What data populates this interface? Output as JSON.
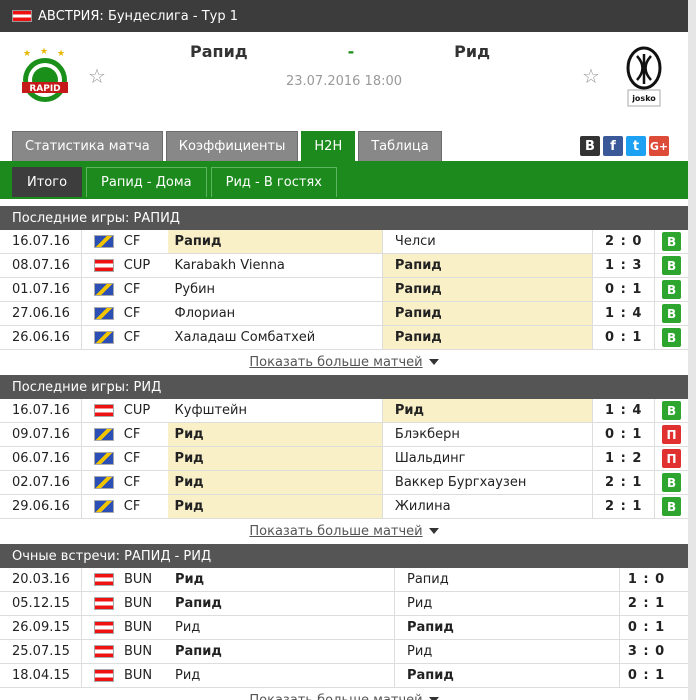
{
  "topbar": {
    "title": "АВСТРИЯ: Бундеслига - Тур 1"
  },
  "match": {
    "home": "Рапид",
    "separator": "-",
    "away": "Рид",
    "datetime": "23.07.2016 18:00",
    "home_logo_text": "RAPID",
    "away_logo_text": "josko"
  },
  "tabs": [
    "Статистика матча",
    "Коэффициенты",
    "H2H",
    "Таблица"
  ],
  "active_tab": "H2H",
  "social": [
    {
      "label": "В",
      "color": "#333333"
    },
    {
      "label": "f",
      "color": "#3b5998"
    },
    {
      "label": "t",
      "color": "#1da1f2"
    },
    {
      "label": "G+",
      "color": "#dd4b39"
    }
  ],
  "subtabs": [
    "Итого",
    "Рапид - Дома",
    "Рид - В гостях"
  ],
  "more_label": "Показать больше матчей",
  "sections": [
    {
      "title": "Последние игры: РАПИД",
      "rows": [
        {
          "date": "16.07.16",
          "league": "CF",
          "flag": "cf",
          "home": "Рапид",
          "away": "Челси",
          "score": "2 : 0",
          "result": "В",
          "hl": "home"
        },
        {
          "date": "08.07.16",
          "league": "CUP",
          "flag": "at",
          "home": "Karabakh Vienna",
          "away": "Рапид",
          "score": "1 : 3",
          "result": "В",
          "hl": "away"
        },
        {
          "date": "01.07.16",
          "league": "CF",
          "flag": "cf",
          "home": "Рубин",
          "away": "Рапид",
          "score": "0 : 1",
          "result": "В",
          "hl": "away"
        },
        {
          "date": "27.06.16",
          "league": "CF",
          "flag": "cf",
          "home": "Флориан",
          "away": "Рапид",
          "score": "1 : 4",
          "result": "В",
          "hl": "away"
        },
        {
          "date": "26.06.16",
          "league": "CF",
          "flag": "cf",
          "home": "Халадаш Сомбатхей",
          "away": "Рапид",
          "score": "0 : 1",
          "result": "В",
          "hl": "away"
        }
      ]
    },
    {
      "title": "Последние игры: РИД",
      "rows": [
        {
          "date": "16.07.16",
          "league": "CUP",
          "flag": "at",
          "home": "Куфштейн",
          "away": "Рид",
          "score": "1 : 4",
          "result": "В",
          "hl": "away"
        },
        {
          "date": "09.07.16",
          "league": "CF",
          "flag": "cf",
          "home": "Рид",
          "away": "Блэкберн",
          "score": "0 : 1",
          "result": "П",
          "hl": "home"
        },
        {
          "date": "06.07.16",
          "league": "CF",
          "flag": "cf",
          "home": "Рид",
          "away": "Шальдинг",
          "score": "1 : 2",
          "result": "П",
          "hl": "home"
        },
        {
          "date": "02.07.16",
          "league": "CF",
          "flag": "cf",
          "home": "Рид",
          "away": "Ваккер Бургхаузен",
          "score": "2 : 1",
          "result": "В",
          "hl": "home"
        },
        {
          "date": "29.06.16",
          "league": "CF",
          "flag": "cf",
          "home": "Рид",
          "away": "Жилина",
          "score": "2 : 1",
          "result": "В",
          "hl": "home"
        }
      ]
    },
    {
      "title": "Очные встречи: РАПИД - РИД",
      "rows": [
        {
          "date": "20.03.16",
          "league": "BUN",
          "flag": "at",
          "home": "Рид",
          "away": "Рапид",
          "score": "1 : 0",
          "result": ""
        },
        {
          "date": "05.12.15",
          "league": "BUN",
          "flag": "at",
          "home": "Рапид",
          "away": "Рид",
          "score": "2 : 1",
          "result": ""
        },
        {
          "date": "26.09.15",
          "league": "BUN",
          "flag": "at",
          "home": "Рид",
          "away": "Рапид",
          "score": "0 : 1",
          "result": ""
        },
        {
          "date": "25.07.15",
          "league": "BUN",
          "flag": "at",
          "home": "Рапид",
          "away": "Рид",
          "score": "3 : 0",
          "result": ""
        },
        {
          "date": "18.04.15",
          "league": "BUN",
          "flag": "at",
          "home": "Рид",
          "away": "Рапид",
          "score": "0 : 1",
          "result": ""
        }
      ]
    }
  ]
}
